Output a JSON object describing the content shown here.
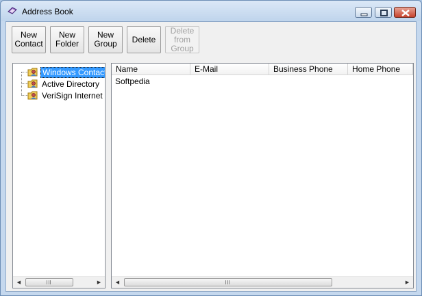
{
  "window": {
    "title": "Address Book",
    "icon": "address-book-icon"
  },
  "window_controls": {
    "minimize": "minimize-icon",
    "maximize": "maximize-icon",
    "close": "close-icon"
  },
  "toolbar": {
    "new_contact": [
      "New",
      "Contact"
    ],
    "new_folder": [
      "New",
      "Folder"
    ],
    "new_group": [
      "New",
      "Group"
    ],
    "delete": [
      "Delete"
    ],
    "delete_from_group": [
      "Delete",
      "from",
      "Group"
    ]
  },
  "tree": {
    "items": [
      {
        "label": "Windows Contacts",
        "icon": "contacts-folder-icon",
        "selected": true
      },
      {
        "label": "Active Directory",
        "icon": "contacts-folder-icon",
        "selected": false
      },
      {
        "label": "VeriSign Internet Directory Service",
        "icon": "contacts-folder-icon",
        "selected": false
      }
    ]
  },
  "list": {
    "columns": [
      "Name",
      "E-Mail",
      "Business Phone",
      "Home Phone"
    ],
    "rows": [
      {
        "name": "Softpedia"
      }
    ]
  },
  "colors": {
    "selection": "#3399ff",
    "frame": "#c5d8ee",
    "close_button": "#c6412c"
  },
  "scrollbars": {
    "left_thumb_icon": "scroll-grip-icon",
    "right_thumb_icon": "scroll-grip-icon"
  }
}
